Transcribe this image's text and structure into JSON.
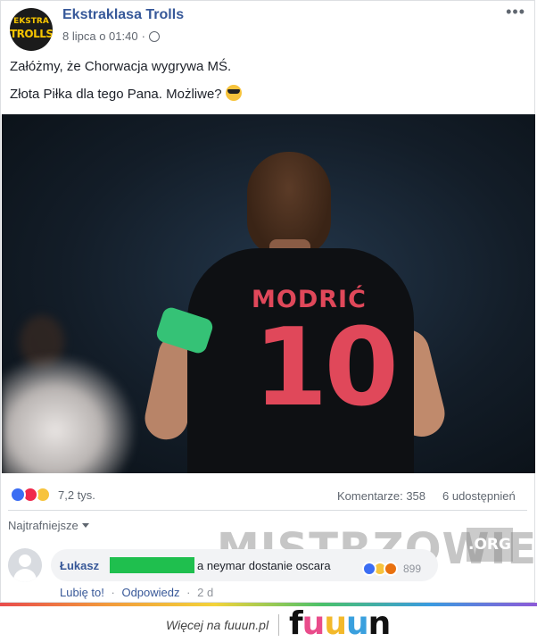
{
  "post": {
    "page_name": "Ekstraklasa Trolls",
    "avatar_line1": "EKSTRA",
    "avatar_line2": "TROLLS",
    "date": "8 lipca o 01:40",
    "date_separator": "·",
    "more_label": "•••",
    "text_line1": "Załóżmy, że Chorwacja wygrywa MŚ.",
    "text_line2": "Złota Piłka dla tego Pana. Możliwe?",
    "photo": {
      "jersey_name": "MODRIĆ",
      "jersey_number": "10"
    }
  },
  "stats": {
    "reactions_count": "7,2 tys.",
    "comments": "Komentarze: 358",
    "shares": "6 udostępnień"
  },
  "comments_section": {
    "sort_label": "Najtrafniejsze",
    "comment": {
      "author": "Łukasz",
      "text": "a neymar dostanie oscara",
      "reactions_count": "899",
      "like_label": "Lubię to!",
      "separator": "·",
      "reply_label": "Odpowiedz",
      "time": "2 d"
    }
  },
  "watermark": {
    "main": "MISTRZOWIE",
    "tld": ".ORG"
  },
  "footer": {
    "text": "Więcej na fuuun.pl",
    "logo_letters": [
      "f",
      "u",
      "u",
      "u",
      "n"
    ],
    "logo_colors": [
      "#111111",
      "#e94c8b",
      "#f3b92b",
      "#3aa0de",
      "#111111"
    ]
  },
  "colors": {
    "link_blue": "#365899",
    "redaction_green": "#1fbf4e",
    "jersey_red": "#e0485a",
    "armband_green": "#35c276"
  }
}
